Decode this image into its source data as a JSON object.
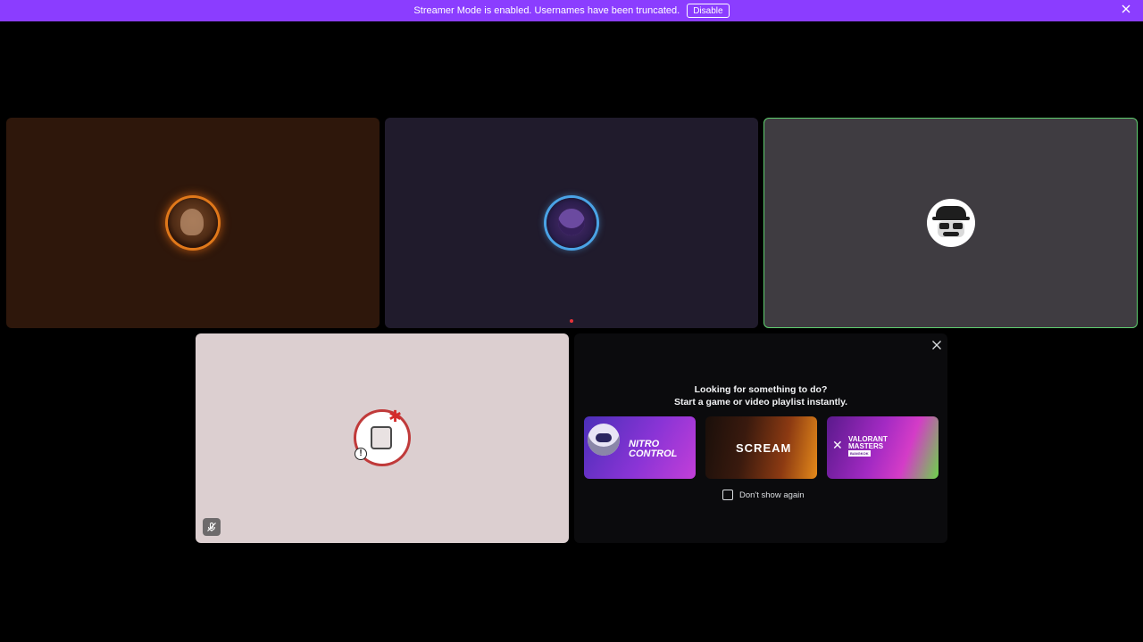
{
  "banner": {
    "message": "Streamer Mode is enabled. Usernames have been truncated.",
    "disable_label": "Disable",
    "close_icon": "close-icon"
  },
  "tiles": [
    {
      "id": "participant-1",
      "background": "#2e170b",
      "ring_color": "#e0781a"
    },
    {
      "id": "participant-2",
      "background": "#201b2c",
      "ring_color": "#4aa3e6"
    },
    {
      "id": "participant-3",
      "background": "#3f3c41",
      "border_color": "#5fcf6f",
      "speaking": true
    },
    {
      "id": "participant-4",
      "background": "#dccfd0",
      "ring_color": "#c03a3a",
      "muted": true
    }
  ],
  "activity_panel": {
    "heading_line1": "Looking for something to do?",
    "heading_line2": "Start a game or video playlist instantly.",
    "cards": [
      {
        "title": "NITRO CONTROL"
      },
      {
        "title": "SCREAM"
      },
      {
        "title": "VALORANT MASTERS",
        "badge": "BANGKOK"
      }
    ],
    "checkbox_label": "Don't show again",
    "checkbox_checked": false
  },
  "colors": {
    "banner": "#8b3dff",
    "speaking_border": "#5fcf6f",
    "panel_bg": "#0b0b0d"
  }
}
